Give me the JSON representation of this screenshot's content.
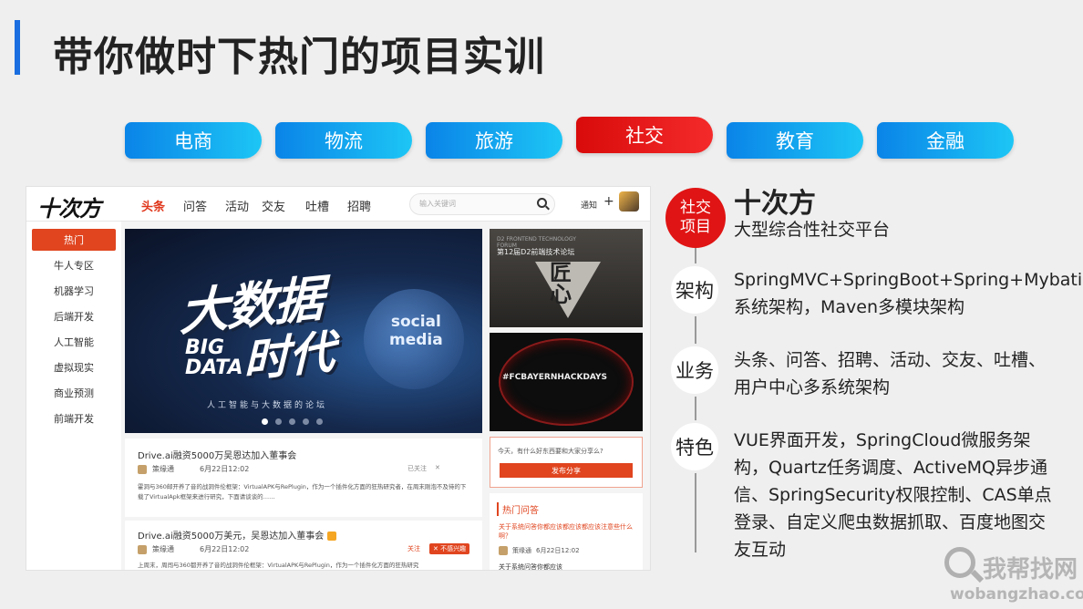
{
  "page": {
    "title": "带你做时下热门的项目实训"
  },
  "categories": [
    {
      "label": "电商",
      "active": false
    },
    {
      "label": "物流",
      "active": false
    },
    {
      "label": "旅游",
      "active": false
    },
    {
      "label": "社交",
      "active": true
    },
    {
      "label": "教育",
      "active": false
    },
    {
      "label": "金融",
      "active": false
    }
  ],
  "colors": {
    "accent_blue": "#1a6ee0",
    "active_red": "#e01414",
    "site_orange": "#e0451f"
  },
  "screenshot": {
    "logo": "十次方",
    "nav": [
      "头条",
      "问答",
      "活动",
      "交友",
      "吐槽",
      "招聘"
    ],
    "search_placeholder": "输入关键词",
    "notify": "通知",
    "plus": "+",
    "side_nav": [
      "热门",
      "牛人专区",
      "机器学习",
      "后端开发",
      "人工智能",
      "虚拟现实",
      "商业预测",
      "前端开发"
    ],
    "banner": {
      "big": "大数据",
      "time": "时代",
      "bigdata": "BIG\nDATA",
      "social": "social\nmedia",
      "sub": "人工智能与大数据的论坛"
    },
    "promo1": {
      "head": "D2 FRONTEND TECHNOLOGY FORUM",
      "title": "第12届D2前端技术论坛",
      "art": "匠\n心"
    },
    "promo2": {
      "text": "#FCBAYERNHACKDAYS"
    },
    "articles": [
      {
        "title": "Drive.ai融资5000万吴恩达加入董事会",
        "author": "策缘通",
        "date": "6月22日12:02",
        "status": "已关注",
        "close": "✕",
        "body": "霍洞与360邮开养了音的战洞件伦框架：VirtualAPK与RePlugin，作为一个插件化方面的狂热研究者，在周末刚泡不及待的下载了VirtualApk框架来进行研究，下面请谈谈的……"
      },
      {
        "title": "Drive.ai融资5000万美元，吴恩达加入董事会",
        "author": "策缘通",
        "date": "6月22日12:02",
        "follow": "关注",
        "dislike": "✕ 不感兴趣",
        "body": "上周末，周闯与360都开养了音的战洞件伦框架：VirtualAPK与RePlugin，作为一个插件化方面的狂热研究"
      }
    ],
    "share": {
      "question": "今天，有什么好东西要和大家分享么?",
      "button": "发布分享"
    },
    "hot": {
      "title": "热门问答",
      "question": "关于系统问答你都应该都应该都应该注意些什么啊？",
      "author": "策缘通",
      "date": "6月22日12:02",
      "next": "关于系统问答你都应该"
    }
  },
  "panel": {
    "badge": "社交\n项目",
    "name": "十次方",
    "desc": "大型综合性社交平台",
    "sections": [
      {
        "label": "架构",
        "text": "SpringMVC+SpringBoot+Spring+Mybatis系统架构，Maven多模块架构"
      },
      {
        "label": "业务",
        "text": "头条、问答、招聘、活动、交友、吐槽、用户中心多系统架构"
      },
      {
        "label": "特色",
        "text": "VUE界面开发，SpringCloud微服务架构，Quartz任务调度、ActiveMQ异步通信、SpringSecurity权限控制、CAS单点登录、自定义爬虫数据抓取、百度地图交友互动"
      }
    ]
  },
  "watermark": {
    "text": "我帮找网",
    "url": "wobangzhao.com"
  }
}
